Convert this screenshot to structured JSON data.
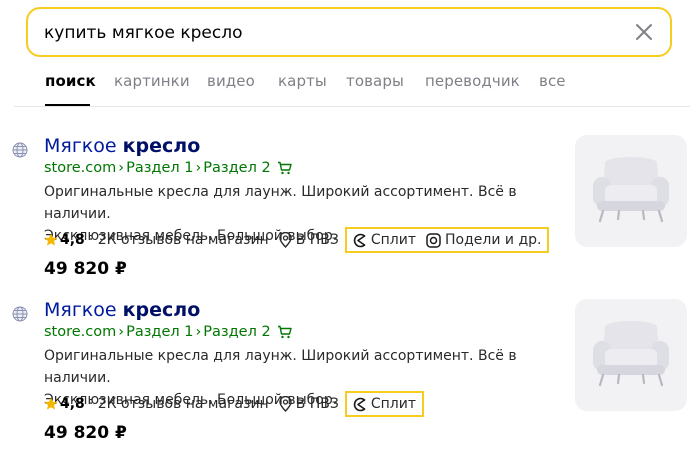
{
  "search": {
    "query": "купить мягкое кресло"
  },
  "tabs": [
    {
      "label": "поиск"
    },
    {
      "label": "картинки"
    },
    {
      "label": "видео"
    },
    {
      "label": "карты"
    },
    {
      "label": "товары"
    },
    {
      "label": "переводчик"
    },
    {
      "label": "все"
    }
  ],
  "colors": {
    "highlight": "#f5cc1f",
    "title": "#001a9c",
    "url": "#007700"
  },
  "results": [
    {
      "title_plain": "Мягкое ",
      "title_bold": "кресло",
      "crumbs": [
        "store.com",
        "Раздел 1",
        "Раздел 2"
      ],
      "crumb_sep": "›",
      "snippet_line1": "Оригинальные кресла для лаунж. Широкий ассортимент. Всё в наличии.",
      "snippet_line2": "Эксклюзивная мебель. Большой выбор.",
      "rating": "4,8",
      "reviews": "· 2К отзывов на магазин",
      "pickup": "В ПВЗ",
      "badges": [
        "Сплит",
        "Подели и др."
      ],
      "price": "49 820 ₽"
    },
    {
      "title_plain": "Мягкое ",
      "title_bold": "кресло",
      "crumbs": [
        "store.com",
        "Раздел 1",
        "Раздел 2"
      ],
      "crumb_sep": "›",
      "snippet_line1": "Оригинальные кресла для лаунж. Широкий ассортимент. Всё в наличии.",
      "snippet_line2": "Эксклюзивная мебель. Большой выбор.",
      "rating": "4,8",
      "reviews": "· 2К отзывов на магазин",
      "pickup": "В ПВЗ",
      "badges": [
        "Сплит"
      ],
      "price": "49 820 ₽"
    }
  ]
}
